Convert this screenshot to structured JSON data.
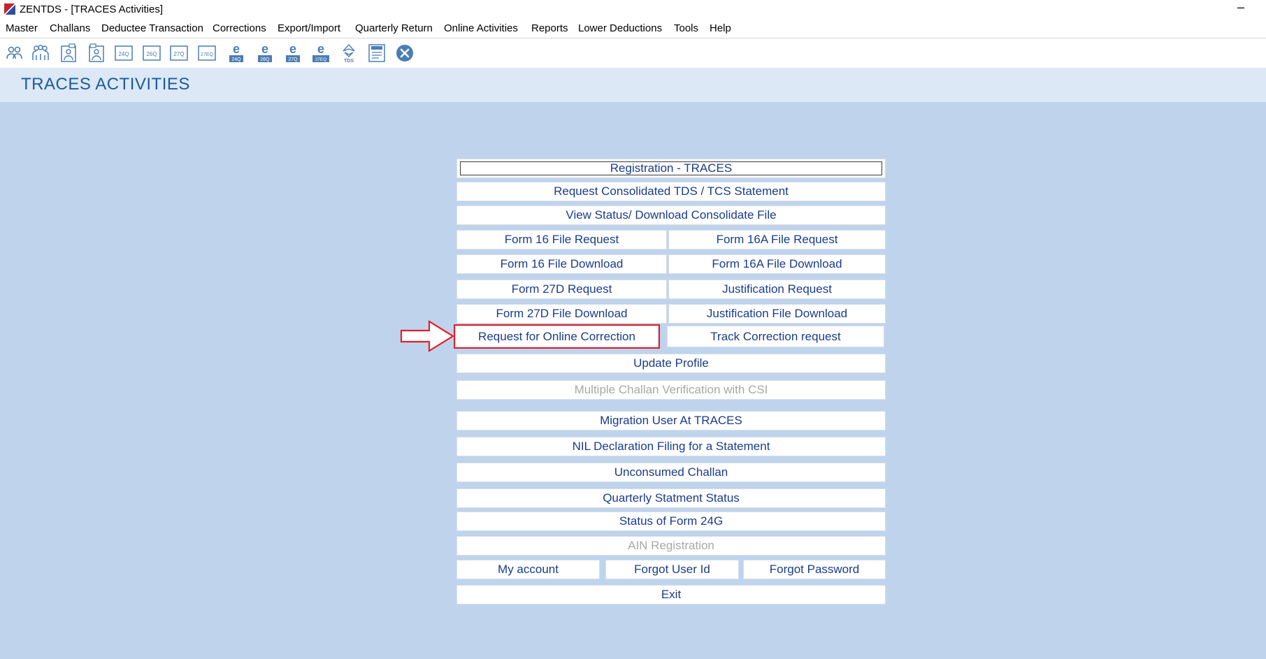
{
  "window": {
    "title": "ZENTDS - [TRACES Activities]",
    "minimize_glyph": "–"
  },
  "menu": [
    "Master",
    "Challans",
    "Deductee Transaction",
    "Corrections",
    "Export/Import",
    "Quarterly Return",
    "Online Activities",
    "Reports",
    "Lower Deductions",
    "Tools",
    "Help"
  ],
  "toolbar_icons": [
    "deductor-icon",
    "deductees-icon",
    "form-person-icon",
    "form-person-alt-icon",
    "form-24q-icon",
    "form-26q-icon",
    "form-27q-icon",
    "form-27eq-icon",
    "e-24q-icon",
    "e-26q-icon",
    "e-27q-icon",
    "e-27eq-icon",
    "tds-icon",
    "certificate-icon",
    "close-circle-icon"
  ],
  "toolbar_labels": {
    "f24": "24Q",
    "f26": "26Q",
    "f27": "27Q",
    "f27e": "27EQ",
    "e": "e",
    "tds": "TDS"
  },
  "page": {
    "title": "TRACES ACTIVITIES"
  },
  "buttons": {
    "registration": "Registration - TRACES",
    "request_consolidated": "Request Consolidated TDS / TCS Statement",
    "view_status": "View Status/ Download Consolidate File",
    "form16_request": "Form 16 File Request",
    "form16a_request": "Form 16A File Request",
    "form16_download": "Form 16 File Download",
    "form16a_download": "Form 16A File Download",
    "form27d_request": "Form 27D Request",
    "justification_request": "Justification Request",
    "form27d_download": "Form 27D File Download",
    "justification_download": "Justification File Download",
    "request_online_correction": "Request for Online Correction",
    "track_correction": "Track Correction request",
    "update_profile": "Update Profile",
    "multiple_challan": "Multiple Challan Verification with CSI",
    "migration_user": "Migration User At TRACES",
    "nil_declaration": "NIL Declaration Filing for a Statement",
    "unconsumed_challan": "Unconsumed Challan",
    "quarterly_status": "Quarterly Statment Status",
    "status_form24g": "Status of Form 24G",
    "ain_registration": "AIN Registration",
    "my_account": "My account",
    "forgot_user_id": "Forgot User Id",
    "forgot_password": "Forgot Password",
    "exit": "Exit"
  },
  "colors": {
    "highlight": "#e0202a",
    "link_text": "#1a3c8c",
    "title": "#1b5c9c",
    "panel_bg": "#bfd4ec"
  }
}
